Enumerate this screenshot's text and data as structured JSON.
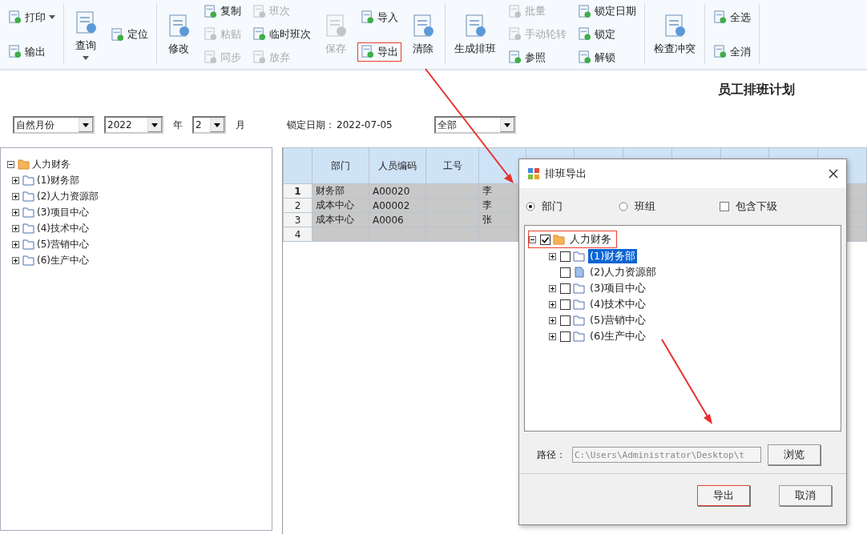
{
  "toolbar": {
    "groups": [
      {
        "columns": [
          {
            "kind": "stack",
            "items": [
              {
                "label": "打印",
                "disabled": false,
                "highlighted": false,
                "has_menu": true
              },
              {
                "label": "输出",
                "disabled": false,
                "highlighted": false,
                "has_menu": false
              }
            ]
          }
        ]
      },
      {
        "columns": [
          {
            "kind": "large",
            "items": [
              {
                "label": "查询",
                "disabled": false,
                "highlighted": false,
                "has_menu": true
              }
            ]
          },
          {
            "kind": "stack",
            "items": [
              {
                "label": "定位",
                "disabled": false,
                "highlighted": false,
                "has_menu": false
              }
            ]
          }
        ]
      },
      {
        "columns": [
          {
            "kind": "large",
            "items": [
              {
                "label": "修改",
                "disabled": false,
                "highlighted": false,
                "has_menu": false
              }
            ]
          },
          {
            "kind": "stack",
            "items": [
              {
                "label": "复制",
                "disabled": false,
                "highlighted": false,
                "has_menu": false
              },
              {
                "label": "粘贴",
                "disabled": true,
                "highlighted": false,
                "has_menu": false
              },
              {
                "label": "同步",
                "disabled": true,
                "highlighted": false,
                "has_menu": false
              }
            ]
          },
          {
            "kind": "stack",
            "items": [
              {
                "label": "班次",
                "disabled": true,
                "highlighted": false,
                "has_menu": false
              },
              {
                "label": "临时班次",
                "disabled": false,
                "highlighted": false,
                "has_menu": false
              },
              {
                "label": "放弃",
                "disabled": true,
                "highlighted": false,
                "has_menu": false
              }
            ]
          },
          {
            "kind": "large",
            "items": [
              {
                "label": "保存",
                "disabled": true,
                "highlighted": false,
                "has_menu": false
              }
            ]
          },
          {
            "kind": "stack",
            "items": [
              {
                "label": "导入",
                "disabled": false,
                "highlighted": false,
                "has_menu": false
              },
              {
                "label": "导出",
                "disabled": false,
                "highlighted": true,
                "has_menu": false
              }
            ]
          },
          {
            "kind": "large",
            "items": [
              {
                "label": "清除",
                "disabled": false,
                "highlighted": false,
                "has_menu": false
              }
            ]
          }
        ]
      },
      {
        "columns": [
          {
            "kind": "large",
            "items": [
              {
                "label": "生成排班",
                "disabled": false,
                "highlighted": false,
                "has_menu": false
              }
            ]
          },
          {
            "kind": "stack",
            "items": [
              {
                "label": "批量",
                "disabled": true,
                "highlighted": false,
                "has_menu": false
              },
              {
                "label": "手动轮转",
                "disabled": true,
                "highlighted": false,
                "has_menu": false
              },
              {
                "label": "参照",
                "disabled": false,
                "highlighted": false,
                "has_menu": false
              }
            ]
          },
          {
            "kind": "stack",
            "items": [
              {
                "label": "锁定日期",
                "disabled": false,
                "highlighted": false,
                "has_menu": false
              },
              {
                "label": "锁定",
                "disabled": false,
                "highlighted": false,
                "has_menu": false
              },
              {
                "label": "解锁",
                "disabled": false,
                "highlighted": false,
                "has_menu": false
              }
            ]
          }
        ]
      },
      {
        "columns": [
          {
            "kind": "large",
            "items": [
              {
                "label": "检查冲突",
                "disabled": false,
                "highlighted": false,
                "has_menu": false
              }
            ]
          }
        ]
      },
      {
        "columns": [
          {
            "kind": "stack",
            "items": [
              {
                "label": "全选",
                "disabled": false,
                "highlighted": false,
                "has_menu": false
              },
              {
                "label": "全消",
                "disabled": false,
                "highlighted": false,
                "has_menu": false
              }
            ]
          }
        ]
      }
    ]
  },
  "page_title": "员工排班计划",
  "filters": {
    "period_type": "自然月份",
    "year": "2022",
    "year_label": "年",
    "month": "2",
    "month_label": "月",
    "lock_date_label": "锁定日期：",
    "lock_date": "2022-07-05",
    "scope": "全部"
  },
  "org_tree": {
    "label": "人力财务",
    "expanded": true,
    "children": [
      {
        "label": "(1)财务部",
        "expanded": false
      },
      {
        "label": "(2)人力资源部",
        "expanded": false
      },
      {
        "label": "(3)项目中心",
        "expanded": false
      },
      {
        "label": "(4)技术中心",
        "expanded": false
      },
      {
        "label": "(5)营销中心",
        "expanded": false
      },
      {
        "label": "(6)生产中心",
        "expanded": false
      }
    ]
  },
  "table": {
    "columns": [
      "部门",
      "人员编码",
      "工号"
    ],
    "rows": [
      {
        "number": "1",
        "current": true,
        "department": "财务部",
        "employee_code": "A00020",
        "column_5": "李"
      },
      {
        "number": "2",
        "current": false,
        "department": "成本中心",
        "employee_code": "A00002",
        "column_5": "李"
      },
      {
        "number": "3",
        "current": false,
        "department": "成本中心",
        "employee_code": "A0006",
        "column_5": "张"
      },
      {
        "number": "4",
        "current": false
      }
    ]
  },
  "dialog": {
    "title": "排班导出",
    "modes": [
      {
        "label": "部门",
        "selected": true
      },
      {
        "label": "班组",
        "selected": false
      }
    ],
    "include_sub": {
      "label": "包含下级",
      "checked": false
    },
    "tree": {
      "label": "人力财务",
      "expanded": true,
      "checked": true,
      "selected": false,
      "highlighted": true,
      "children": [
        {
          "label": "(1)财务部",
          "expandable": true,
          "checked": false,
          "selected": true
        },
        {
          "label": "(2)人力资源部",
          "expandable": false,
          "checked": false,
          "selected": false
        },
        {
          "label": "(3)项目中心",
          "expandable": true,
          "checked": false,
          "selected": false
        },
        {
          "label": "(4)技术中心",
          "expandable": true,
          "checked": false,
          "selected": false
        },
        {
          "label": "(5)营销中心",
          "expandable": true,
          "checked": false,
          "selected": false
        },
        {
          "label": "(6)生产中心",
          "expandable": true,
          "checked": false,
          "selected": false
        }
      ]
    },
    "path_label": "路径：",
    "path": "C:\\Users\\Administrator\\Desktop\\t",
    "browse": "浏览",
    "buttons": [
      {
        "label": "导出",
        "highlighted": true
      },
      {
        "label": "取消",
        "highlighted": false
      }
    ]
  }
}
